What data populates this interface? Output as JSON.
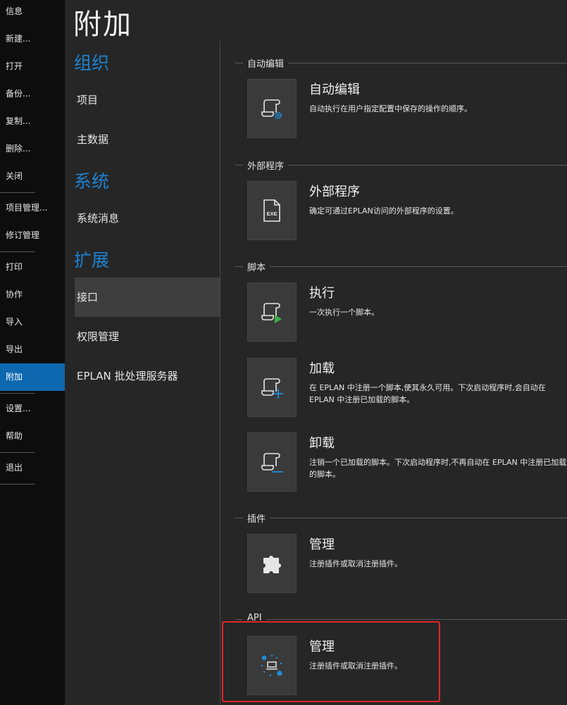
{
  "nav": {
    "items": [
      {
        "label": "信息"
      },
      {
        "label": "新建..."
      },
      {
        "label": "打开"
      },
      {
        "label": "备份..."
      },
      {
        "label": "复制..."
      },
      {
        "label": "删除..."
      },
      {
        "label": "关闭"
      },
      {
        "label": "项目管理..."
      },
      {
        "label": "修订管理"
      },
      {
        "label": "打印"
      },
      {
        "label": "协作"
      },
      {
        "label": "导入"
      },
      {
        "label": "导出"
      },
      {
        "label": "附加",
        "active": true
      },
      {
        "label": "设置..."
      },
      {
        "label": "帮助"
      },
      {
        "label": "退出"
      }
    ]
  },
  "page": {
    "title": "附加"
  },
  "categories": {
    "org": {
      "title": "组织",
      "items": [
        "项目",
        "主数据"
      ]
    },
    "system": {
      "title": "系统",
      "items": [
        "系统消息"
      ]
    },
    "ext": {
      "title": "扩展",
      "items": [
        "接口",
        "权限管理",
        "EPLAN 批处理服务器"
      ],
      "active_index": 0
    }
  },
  "groups": {
    "auto_edit": {
      "label": "自动编辑"
    },
    "external": {
      "label": "外部程序"
    },
    "script": {
      "label": "脚本"
    },
    "plugin": {
      "label": "插件"
    },
    "api": {
      "label": "API"
    }
  },
  "entries": {
    "auto_edit": {
      "title": "自动编辑",
      "desc": "自动执行在用户指定配置中保存的操作的顺序。",
      "icon": "scroll-gear-icon"
    },
    "external": {
      "title": "外部程序",
      "desc": "确定可通过EPLAN访问的外部程序的设置。",
      "icon": "exe-file-icon",
      "badge": "EXE"
    },
    "execute": {
      "title": "执行",
      "desc": "一次执行一个脚本。",
      "icon": "scroll-play-icon"
    },
    "load": {
      "title": "加载",
      "desc": "在 EPLAN 中注册一个脚本,使其永久可用。下次启动程序时,会自动在 EPLAN 中注册已加载的脚本。",
      "icon": "scroll-plus-icon"
    },
    "unload": {
      "title": "卸载",
      "desc": "注销一个已加载的脚本。下次启动程序时,不再自动在 EPLAN 中注册已加载的脚本。",
      "icon": "scroll-minus-icon"
    },
    "plugin_manage": {
      "title": "管理",
      "desc": "注册插件或取消注册插件。",
      "icon": "puzzle-icon"
    },
    "api_manage": {
      "title": "管理",
      "desc": "注册插件或取消注册插件。",
      "icon": "api-network-icon"
    }
  },
  "colors": {
    "accent": "#0e68b0",
    "section_heading": "#1e82d2",
    "play_green": "#3fae49",
    "highlight": "#e0262b"
  }
}
